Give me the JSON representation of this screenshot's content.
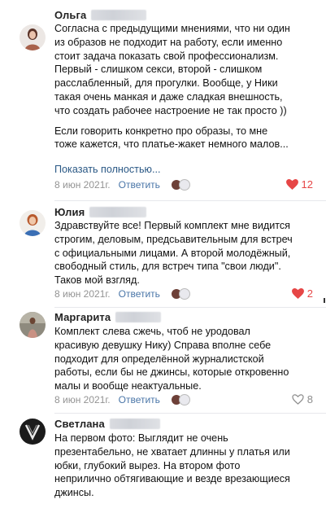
{
  "comments": [
    {
      "author": "Ольга",
      "lines": [
        "Согласна с предыдущими мнениями, что ни один",
        "из образов не подходит на работу, если именно",
        "стоит задача показать свой профессионализм.",
        "Первый - слишком секси, второй - слишком",
        "расслабленный, для прогулки. Вообще, у Ники",
        "такая очень манкая и даже сладкая внешность,",
        "что создать рабочее настроение не так просто ))",
        "",
        "Если говорить конкретно про образы, то мне",
        "тоже кажется, что платье-жакет немного малов..."
      ],
      "show_more": "Показать полностью...",
      "date": "8 июн 2021г.",
      "reply": "Ответить",
      "likes": "12",
      "liked": true,
      "avatar_color": "#a8614b"
    },
    {
      "author": "Юлия",
      "lines": [
        "Здравствуйте все! Первый комплект мне видится",
        "строгим, деловым, предсьавительным для встреч",
        "с официальными лицами. А второй молодёжный,",
        "свободный стиль, для встреч типа \"свои люди\".",
        "Таков мой взгляд."
      ],
      "date": "8 июн 2021г.",
      "reply": "Ответить",
      "likes": "2",
      "liked": true,
      "avatar_color": "#3a6fb5"
    },
    {
      "author": "Маргарита",
      "lines": [
        "Комплект слева сжечь, чтоб не уродовал",
        "красивую девушку Нику) Справа вполне себе",
        "подходит для определённой журналистской",
        "работы, если бы не джинсы, которые откровенно",
        "малы и вообще неактуальные."
      ],
      "date": "8 июн 2021г.",
      "reply": "Ответить",
      "likes": "8",
      "liked": false,
      "avatar_color": "#9a6d5a"
    },
    {
      "author": "Светлана",
      "lines": [
        "На первом фото: Выглядит не очень",
        "презентабельно, не хватает длинны у платья или",
        "юбки, глубокий вырез. На втором фото",
        "неприлично обтягивающие и везде врезающиеся",
        "джинсы."
      ],
      "avatar_color": "#1b1b1b"
    }
  ],
  "colors": {
    "link": "#2a5885",
    "like_active": "#e64646",
    "muted": "#939393"
  }
}
